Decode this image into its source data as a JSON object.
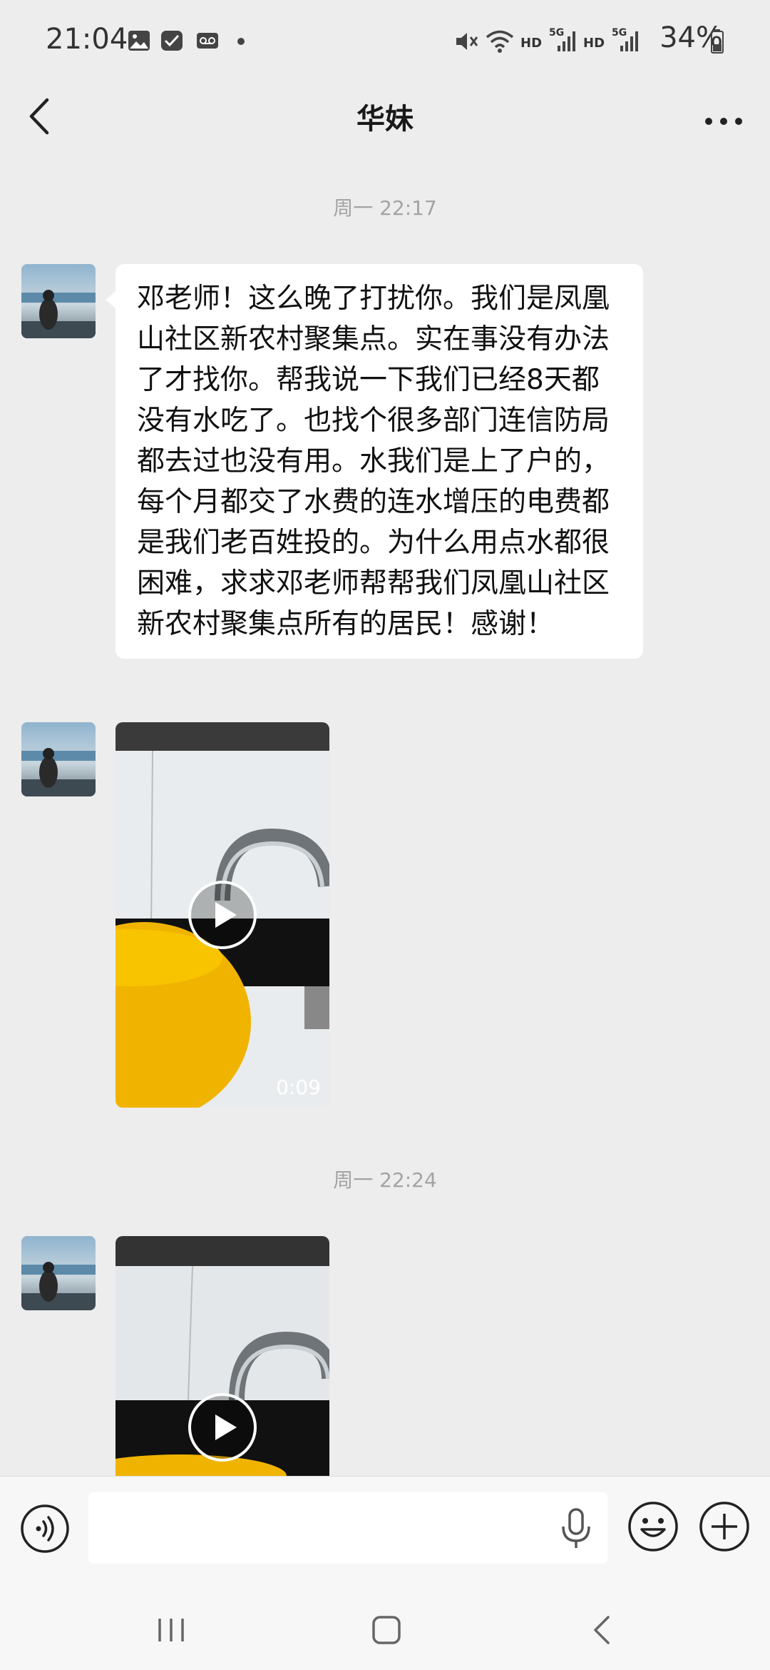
{
  "status_bar": {
    "time": "21:04",
    "battery": "34%",
    "net1": "HD",
    "net2": "5G",
    "net3": "HD",
    "net4": "5G",
    "icons": [
      "image-icon",
      "check-notification-icon",
      "voicemail-icon",
      "dot-icon",
      "mute-icon",
      "wifi-icon",
      "signal-icon",
      "signal-icon",
      "battery-icon"
    ]
  },
  "header": {
    "title": "华妹"
  },
  "messages": {
    "time1": "周一 22:17",
    "text": "邓老师！这么晚了打扰你。我们是凤凰山社区新农村聚集点。实在事没有办法了才找你。帮我说一下我们已经8天都没有水吃了。也找个很多部门连信防局都去过也没有用。水我们是上了户的，每个月都交了水费的连水增压的电费都是我们老百姓投的。为什么用点水都很困难，求求邓老师帮帮我们凤凰山社区新农村聚集点所有的居民！感谢！",
    "video1_duration": "0:09",
    "time2": "周一 22:24"
  },
  "input": {
    "value": ""
  },
  "colors": {
    "background": "#ededed",
    "bubble": "#ffffff",
    "timestamp": "#a3a3a3"
  }
}
